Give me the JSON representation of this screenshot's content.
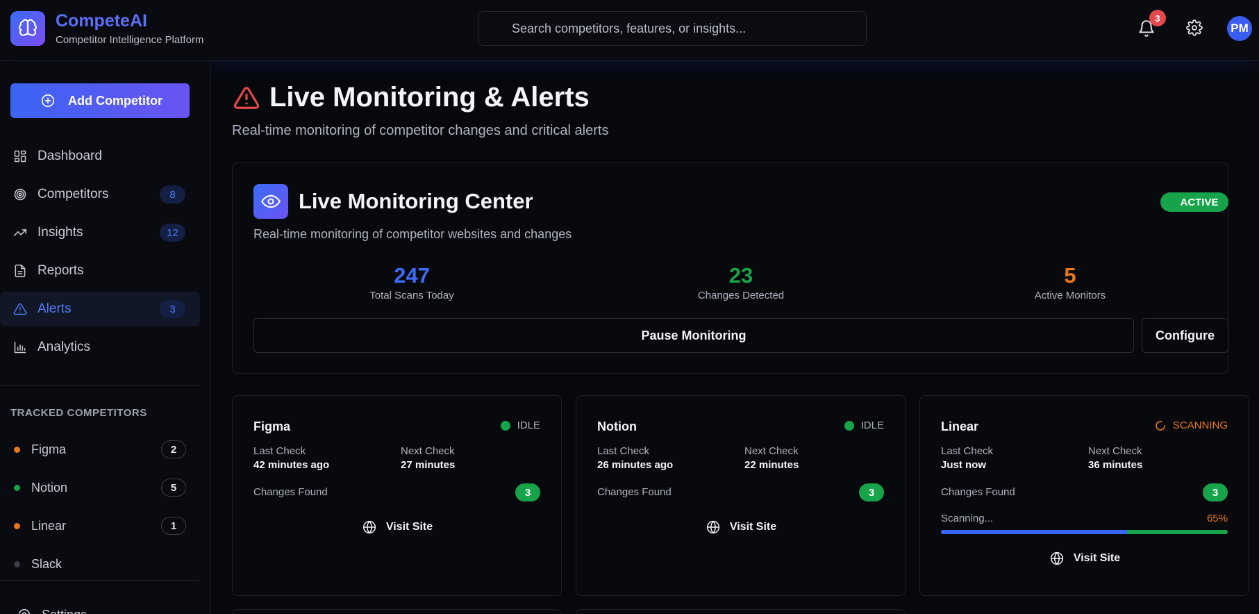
{
  "header": {
    "brand_name": "CompeteAI",
    "brand_sub": "Competitor Intelligence Platform",
    "search_placeholder": "Search competitors, features, or insights...",
    "notification_count": "3",
    "avatar_initials": "PM"
  },
  "sidebar": {
    "add_button": "Add Competitor",
    "nav": [
      {
        "label": "Dashboard",
        "icon": "dashboard-icon",
        "badge": ""
      },
      {
        "label": "Competitors",
        "icon": "target-icon",
        "badge": "8"
      },
      {
        "label": "Insights",
        "icon": "trending-up-icon",
        "badge": "12"
      },
      {
        "label": "Reports",
        "icon": "document-icon",
        "badge": ""
      },
      {
        "label": "Alerts",
        "icon": "alert-triangle-icon",
        "badge": "3",
        "active": true
      },
      {
        "label": "Analytics",
        "icon": "bar-chart-icon",
        "badge": ""
      }
    ],
    "tracked_title": "TRACKED COMPETITORS",
    "tracked": [
      {
        "name": "Figma",
        "count": "2",
        "dot_color": "#e8781a"
      },
      {
        "name": "Notion",
        "count": "5",
        "dot_color": "#16a34a"
      },
      {
        "name": "Linear",
        "count": "1",
        "dot_color": "#e8781a"
      },
      {
        "name": "Slack",
        "count": "",
        "dot_color": "#3a3d46"
      }
    ],
    "settings_label": "Settings"
  },
  "main": {
    "title": "Live Monitoring & Alerts",
    "subtitle": "Real-time monitoring of competitor changes and critical alerts",
    "monitor": {
      "title": "Live Monitoring Center",
      "status": "ACTIVE",
      "subtitle": "Real-time monitoring of competitor websites and changes",
      "stats": [
        {
          "value": "247",
          "label": "Total Scans Today",
          "color": "#3b6cf6"
        },
        {
          "value": "23",
          "label": "Changes Detected",
          "color": "#16a34a"
        },
        {
          "value": "5",
          "label": "Active Monitors",
          "color": "#e8781a"
        }
      ],
      "pause_label": "Pause Monitoring",
      "configure_label": "Configure"
    },
    "competitors": [
      {
        "name": "Figma",
        "status": "IDLE",
        "last_check_label": "Last Check",
        "last_check": "42 minutes ago",
        "next_check_label": "Next Check",
        "next_check": "27 minutes",
        "changes_label": "Changes Found",
        "changes": "3",
        "visit_label": "Visit Site"
      },
      {
        "name": "Notion",
        "status": "IDLE",
        "last_check_label": "Last Check",
        "last_check": "26 minutes ago",
        "next_check_label": "Next Check",
        "next_check": "22 minutes",
        "changes_label": "Changes Found",
        "changes": "3",
        "visit_label": "Visit Site"
      },
      {
        "name": "Linear",
        "status": "SCANNING",
        "last_check_label": "Last Check",
        "last_check": "Just now",
        "next_check_label": "Next Check",
        "next_check": "36 minutes",
        "changes_label": "Changes Found",
        "changes": "3",
        "scanning_label": "Scanning...",
        "progress_text": "65%",
        "progress": 0.65,
        "visit_label": "Visit Site"
      }
    ]
  },
  "colors": {
    "accent": "#3b6cf6",
    "success": "#16a34a",
    "warning": "#e8781a",
    "danger": "#e5484d"
  }
}
